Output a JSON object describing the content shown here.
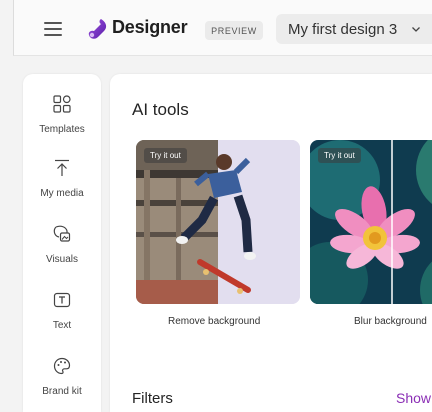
{
  "header": {
    "app_name": "Designer",
    "badge": "PREVIEW",
    "design_name": "My first design 3",
    "brand_color": "#6a2bc4"
  },
  "sidebar": {
    "items": [
      {
        "label": "Templates",
        "icon": "templates-icon"
      },
      {
        "label": "My media",
        "icon": "upload-icon"
      },
      {
        "label": "Visuals",
        "icon": "visuals-icon"
      },
      {
        "label": "Text",
        "icon": "text-icon"
      },
      {
        "label": "Brand kit",
        "icon": "palette-icon"
      }
    ]
  },
  "main": {
    "section_title": "AI tools",
    "tools": [
      {
        "chip": "Try it out",
        "label": "Remove background"
      },
      {
        "chip": "Try it out",
        "label": "Blur background"
      }
    ],
    "filters_title": "Filters",
    "show_link": "Show",
    "link_color": "#8b2fb5"
  }
}
